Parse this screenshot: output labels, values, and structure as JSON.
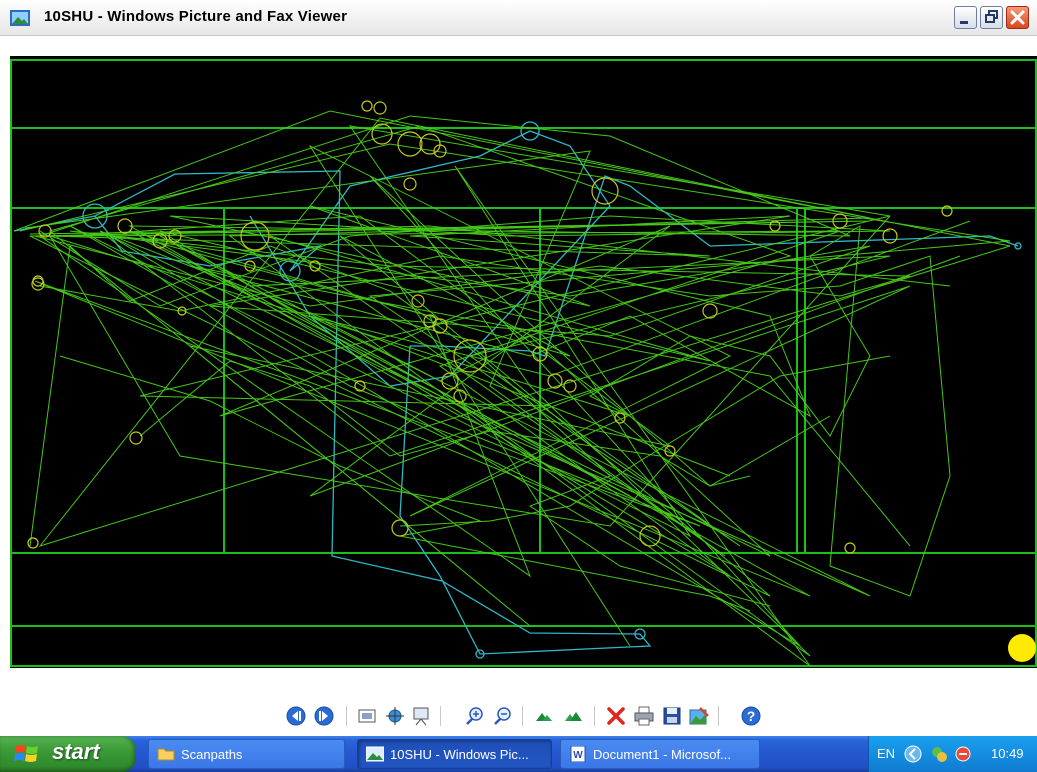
{
  "window": {
    "title": "10SHU - Windows Picture and Fax Viewer",
    "icon": "picture-viewer-icon",
    "controls": [
      "minimize-icon",
      "restore-icon",
      "close-icon"
    ]
  },
  "image": {
    "description_icon": "scanpath-image",
    "colors": {
      "background": "#000000",
      "grid": "#18c018",
      "scanpath_primary": "#4ad21a",
      "scanpath_secondary": "#2fb7c8",
      "fixation": "#c8c81e",
      "marker": "#ffeb00"
    }
  },
  "toolbar": {
    "buttons": [
      {
        "name": "previous-image-button",
        "icon": "previous-icon"
      },
      {
        "name": "next-image-button",
        "icon": "next-icon"
      },
      {
        "name": "best-fit-button",
        "icon": "best-fit-icon"
      },
      {
        "name": "actual-size-button",
        "icon": "actual-size-icon"
      },
      {
        "name": "slideshow-button",
        "icon": "slideshow-icon"
      },
      {
        "name": "zoom-in-button",
        "icon": "zoom-in-icon"
      },
      {
        "name": "zoom-out-button",
        "icon": "zoom-out-icon"
      },
      {
        "name": "rotate-clockwise-button",
        "icon": "rotate-clockwise-icon"
      },
      {
        "name": "rotate-counterclockwise-button",
        "icon": "rotate-counterclockwise-icon"
      },
      {
        "name": "delete-button",
        "icon": "delete-icon"
      },
      {
        "name": "print-button",
        "icon": "print-icon"
      },
      {
        "name": "save-button",
        "icon": "save-icon"
      },
      {
        "name": "edit-button",
        "icon": "edit-icon"
      },
      {
        "name": "help-button",
        "icon": "help-icon"
      }
    ]
  },
  "taskbar": {
    "start_label": "start",
    "tasks": [
      {
        "label": "Scanpaths",
        "icon": "folder-icon",
        "active": false
      },
      {
        "label": "10SHU - Windows Pic...",
        "icon": "picture-viewer-icon",
        "active": true
      },
      {
        "label": "Document1 - Microsof...",
        "icon": "word-icon",
        "active": false
      }
    ],
    "tray": {
      "language": "EN",
      "clock": "10:49",
      "icons": [
        "tray-expand-icon",
        "network-icon",
        "security-icon"
      ]
    }
  }
}
